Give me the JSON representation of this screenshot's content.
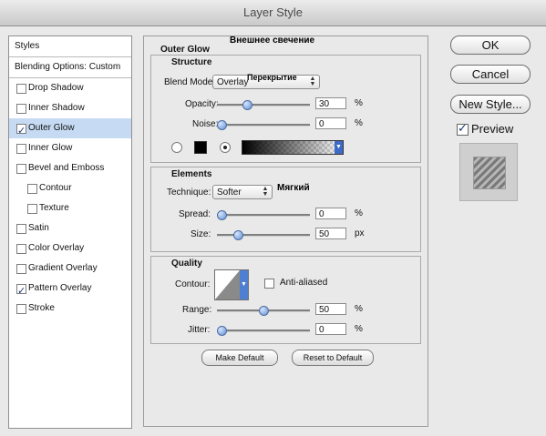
{
  "window": {
    "title": "Layer Style"
  },
  "styles": {
    "header": "Styles",
    "blending": "Blending Options: Custom",
    "items": [
      {
        "label": "Drop Shadow",
        "checked": false,
        "sub": false,
        "selected": false
      },
      {
        "label": "Inner Shadow",
        "checked": false,
        "sub": false,
        "selected": false
      },
      {
        "label": "Outer Glow",
        "checked": true,
        "sub": false,
        "selected": true
      },
      {
        "label": "Inner Glow",
        "checked": false,
        "sub": false,
        "selected": false
      },
      {
        "label": "Bevel and Emboss",
        "checked": false,
        "sub": false,
        "selected": false
      },
      {
        "label": "Contour",
        "checked": false,
        "sub": true,
        "selected": false
      },
      {
        "label": "Texture",
        "checked": false,
        "sub": true,
        "selected": false
      },
      {
        "label": "Satin",
        "checked": false,
        "sub": false,
        "selected": false
      },
      {
        "label": "Color Overlay",
        "checked": false,
        "sub": false,
        "selected": false
      },
      {
        "label": "Gradient Overlay",
        "checked": false,
        "sub": false,
        "selected": false
      },
      {
        "label": "Pattern Overlay",
        "checked": true,
        "sub": false,
        "selected": false
      },
      {
        "label": "Stroke",
        "checked": false,
        "sub": false,
        "selected": false
      }
    ]
  },
  "panel": {
    "title": "Outer Glow",
    "title_ru": "Внешнее свечение",
    "structure": {
      "title": "Structure",
      "blend_mode_label": "Blend Mode:",
      "blend_mode_value": "Overlay",
      "blend_mode_ru": "Перекрытие",
      "opacity_label": "Opacity:",
      "opacity_value": "30",
      "opacity_pct": 0.3,
      "noise_label": "Noise:",
      "noise_value": "0",
      "noise_pct": 0,
      "unit_percent": "%",
      "fill_mode": "gradient",
      "swatch_color": "#000000"
    },
    "elements": {
      "title": "Elements",
      "technique_label": "Technique:",
      "technique_value": "Softer",
      "technique_ru": "Мягкий",
      "spread_label": "Spread:",
      "spread_value": "0",
      "spread_pct": 0,
      "size_label": "Size:",
      "size_value": "50",
      "size_pct": 0.2,
      "unit_percent": "%",
      "unit_px": "px"
    },
    "quality": {
      "title": "Quality",
      "contour_label": "Contour:",
      "anti_aliased_label": "Anti-aliased",
      "anti_aliased": false,
      "range_label": "Range:",
      "range_value": "50",
      "range_pct": 0.5,
      "jitter_label": "Jitter:",
      "jitter_value": "0",
      "jitter_pct": 0,
      "unit_percent": "%"
    },
    "buttons": {
      "make_default": "Make Default",
      "reset_default": "Reset to Default"
    }
  },
  "side": {
    "ok": "OK",
    "cancel": "Cancel",
    "new_style": "New Style...",
    "preview_label": "Preview",
    "preview_checked": true
  },
  "colors": {
    "accent": "#5f8fd3",
    "selected_row": "#c6dbf3"
  }
}
